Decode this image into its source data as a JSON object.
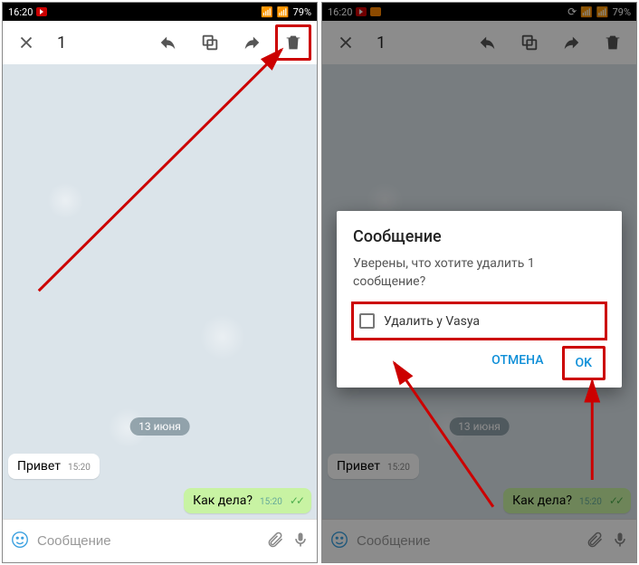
{
  "status": {
    "time": "16:20",
    "battery": "79%"
  },
  "toolbar": {
    "count": "1"
  },
  "chat": {
    "date": "13 июня",
    "msg_in": {
      "text": "Привет",
      "time": "15:20"
    },
    "msg_out": {
      "text": "Как дела?",
      "time": "15:20"
    }
  },
  "input": {
    "placeholder": "Сообщение"
  },
  "dialog": {
    "title": "Сообщение",
    "body": "Уверены, что хотите удалить 1 сообщение?",
    "checkbox": "Удалить у Vasya",
    "cancel": "ОТМЕНА",
    "ok": "OK"
  }
}
